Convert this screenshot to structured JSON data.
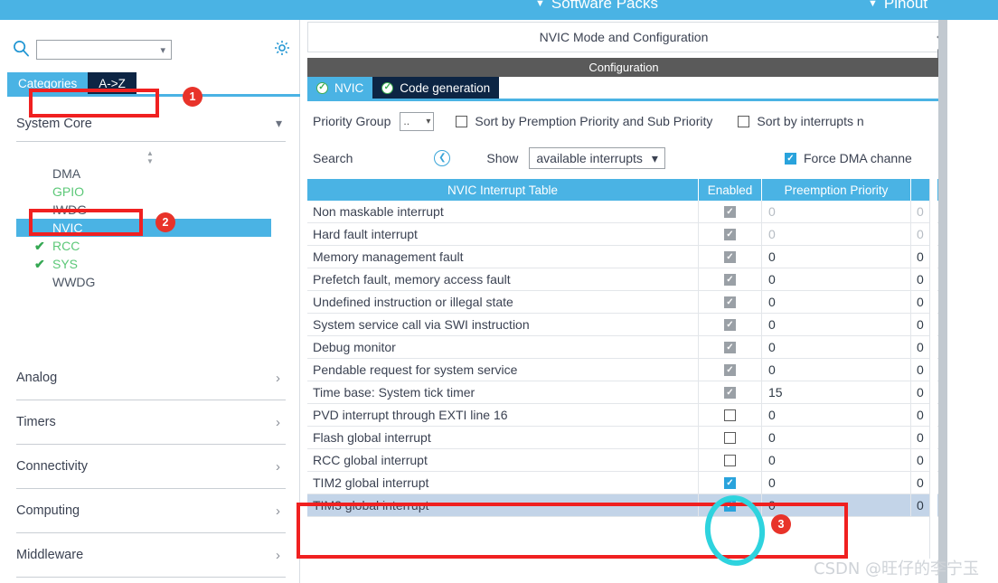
{
  "topbar": {
    "items": [
      {
        "label": "Software Packs",
        "icon": "chevron-down-icon"
      },
      {
        "label": "Pinout",
        "icon": "chevron-down-icon"
      }
    ],
    "bg_color": "#4ab3e4"
  },
  "sidebar": {
    "search": {
      "value": "",
      "placeholder": "",
      "icon": "search-icon",
      "chevron": "chevron-down-icon"
    },
    "gear": {
      "icon": "gear-icon"
    },
    "tabs": [
      {
        "label": "Categories",
        "active": true
      },
      {
        "label": "A->Z",
        "active": false
      }
    ],
    "category_open": {
      "label": "System Core",
      "chevron": "chevron-down-icon"
    },
    "peripherals": [
      {
        "label": "DMA",
        "state": "gray",
        "checked": false,
        "selected": false
      },
      {
        "label": "GPIO",
        "state": "green",
        "checked": false,
        "selected": false
      },
      {
        "label": "IWDG",
        "state": "gray",
        "checked": false,
        "selected": false
      },
      {
        "label": "NVIC",
        "state": "selected",
        "checked": false,
        "selected": true
      },
      {
        "label": "RCC",
        "state": "green",
        "checked": true,
        "selected": false
      },
      {
        "label": "SYS",
        "state": "green",
        "checked": true,
        "selected": false
      },
      {
        "label": "WWDG",
        "state": "gray",
        "checked": false,
        "selected": false
      }
    ],
    "categories": [
      {
        "label": "Analog",
        "chevron": "chevron-right-icon"
      },
      {
        "label": "Timers",
        "chevron": "chevron-right-icon"
      },
      {
        "label": "Connectivity",
        "chevron": "chevron-right-icon"
      },
      {
        "label": "Computing",
        "chevron": "chevron-right-icon"
      },
      {
        "label": "Middleware",
        "chevron": "chevron-right-icon"
      }
    ]
  },
  "main": {
    "mode_title": "NVIC Mode and Configuration",
    "configuration_title": "Configuration",
    "tabs": [
      {
        "label": "NVIC",
        "active": true,
        "icon": "check-circle-icon"
      },
      {
        "label": "Code generation",
        "active": false,
        "icon": "check-circle-icon"
      }
    ],
    "options": {
      "priority_group_label": "Priority Group",
      "priority_group_value": "..",
      "sort_premption_label": "Sort by Premption Priority and Sub Priority",
      "sort_premption_checked": false,
      "sort_interrupts_label": "Sort by interrupts n",
      "sort_interrupts_checked": false,
      "search_label": "Search",
      "search_circle_icon": "chevron-left-circle-icon",
      "show_label": "Show",
      "show_value": "available interrupts",
      "show_chevron": "chevron-down-icon",
      "force_dma_label": "Force DMA channe",
      "force_dma_checked": true
    },
    "table": {
      "headers": [
        "NVIC Interrupt Table",
        "Enabled",
        "Preemption Priority",
        ""
      ],
      "rows": [
        {
          "name": "Non maskable interrupt",
          "enabled": "disabled-checked",
          "preemption": "0",
          "sub": "0",
          "dim": true,
          "highlight": false
        },
        {
          "name": "Hard fault interrupt",
          "enabled": "disabled-checked",
          "preemption": "0",
          "sub": "0",
          "dim": true,
          "highlight": false
        },
        {
          "name": "Memory management fault",
          "enabled": "disabled-checked",
          "preemption": "0",
          "sub": "0",
          "dim": false,
          "highlight": false
        },
        {
          "name": "Prefetch fault, memory access fault",
          "enabled": "disabled-checked",
          "preemption": "0",
          "sub": "0",
          "dim": false,
          "highlight": false
        },
        {
          "name": "Undefined instruction or illegal state",
          "enabled": "disabled-checked",
          "preemption": "0",
          "sub": "0",
          "dim": false,
          "highlight": false
        },
        {
          "name": "System service call via SWI instruction",
          "enabled": "disabled-checked",
          "preemption": "0",
          "sub": "0",
          "dim": false,
          "highlight": false
        },
        {
          "name": "Debug monitor",
          "enabled": "disabled-checked",
          "preemption": "0",
          "sub": "0",
          "dim": false,
          "highlight": false
        },
        {
          "name": "Pendable request for system service",
          "enabled": "disabled-checked",
          "preemption": "0",
          "sub": "0",
          "dim": false,
          "highlight": false
        },
        {
          "name": "Time base: System tick timer",
          "enabled": "disabled-checked",
          "preemption": "15",
          "sub": "0",
          "dim": false,
          "highlight": false
        },
        {
          "name": "PVD interrupt through EXTI line 16",
          "enabled": "unchecked",
          "preemption": "0",
          "sub": "0",
          "dim": false,
          "highlight": false
        },
        {
          "name": "Flash global interrupt",
          "enabled": "unchecked",
          "preemption": "0",
          "sub": "0",
          "dim": false,
          "highlight": false
        },
        {
          "name": "RCC global interrupt",
          "enabled": "unchecked",
          "preemption": "0",
          "sub": "0",
          "dim": false,
          "highlight": false
        },
        {
          "name": "TIM2 global interrupt",
          "enabled": "checked",
          "preemption": "0",
          "sub": "0",
          "dim": false,
          "highlight": false
        },
        {
          "name": "TIM3 global interrupt",
          "enabled": "checked",
          "preemption": "0",
          "sub": "0",
          "dim": false,
          "highlight": true
        }
      ]
    }
  },
  "annotations": {
    "badges": [
      {
        "label": "1"
      },
      {
        "label": "2"
      },
      {
        "label": "3"
      }
    ],
    "box_color": "#f02020",
    "circle_color": "#2ed3de",
    "badge_color": "#e8332a"
  },
  "watermark": {
    "text": "CSDN @旺仔的李宁玉"
  }
}
